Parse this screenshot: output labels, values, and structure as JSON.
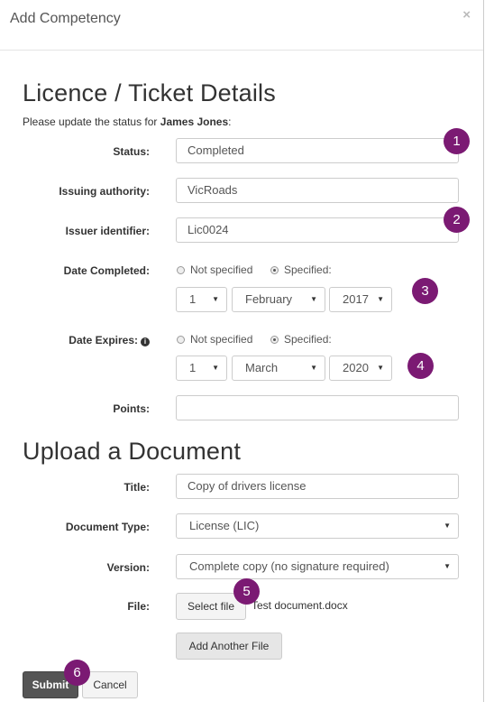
{
  "dialog": {
    "title": "Add Competency",
    "close": "×"
  },
  "licence": {
    "heading": "Licence / Ticket Details",
    "intro_prefix": "Please update the status for ",
    "intro_name": "James Jones",
    "intro_suffix": ":",
    "status_label": "Status:",
    "status_value": "Completed",
    "issuing_label": "Issuing authority:",
    "issuing_value": "VicRoads",
    "issuer_id_label": "Issuer identifier:",
    "issuer_id_value": "Lic0024",
    "completed_label": "Date Completed:",
    "completed": {
      "not_specified": "Not specified",
      "specified": "Specified:",
      "selected": "specified",
      "day": "1",
      "month": "February",
      "year": "2017"
    },
    "expires_label": "Date Expires:",
    "expires": {
      "not_specified": "Not specified",
      "specified": "Specified:",
      "selected": "specified",
      "day": "1",
      "month": "March",
      "year": "2020"
    },
    "points_label": "Points:",
    "points_value": ""
  },
  "upload": {
    "heading": "Upload a Document",
    "title_label": "Title:",
    "title_value": "Copy of drivers license",
    "doctype_label": "Document Type:",
    "doctype_value": "License (LIC)",
    "version_label": "Version:",
    "version_value": "Complete copy (no signature required)",
    "file_label": "File:",
    "select_file": "Select file",
    "file_name": "Test document.docx",
    "add_another": "Add Another File"
  },
  "footer": {
    "submit": "Submit",
    "cancel": "Cancel"
  },
  "badges": [
    "1",
    "2",
    "3",
    "4",
    "5",
    "6"
  ],
  "colors": {
    "badge": "#7b1a73",
    "submit": "#555555"
  }
}
